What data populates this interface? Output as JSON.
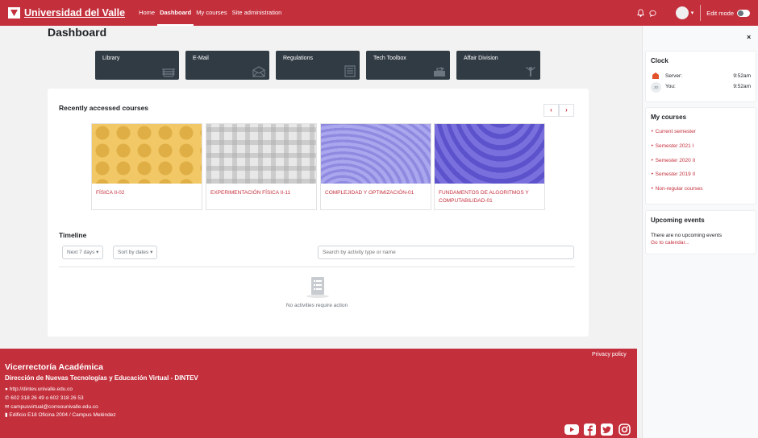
{
  "brand": {
    "name": "Universidad del Valle"
  },
  "nav": {
    "links": [
      "Home",
      "Dashboard",
      "My courses",
      "Site administration"
    ],
    "edit_mode_label": "Edit mode"
  },
  "page": {
    "title": "Dashboard"
  },
  "tiles": [
    {
      "label": "Library",
      "icon": "books-icon"
    },
    {
      "label": "E-Mail",
      "icon": "envelope-icon"
    },
    {
      "label": "Regulations",
      "icon": "list-icon"
    },
    {
      "label": "Tech Toolbox",
      "icon": "toolbox-icon"
    },
    {
      "label": "Affair Division",
      "icon": "person-icon"
    }
  ],
  "recent": {
    "title": "Recently accessed courses",
    "prev_glyph": "‹",
    "next_glyph": "›",
    "courses": [
      {
        "name": "FÍSICA II-02",
        "pattern": "yellow-hexagons"
      },
      {
        "name": "EXPERIMENTACIÓN FÍSICA II-11",
        "pattern": "grey-plaid"
      },
      {
        "name": "COMPLEJIDAD Y OPTIMIZACIÓN-01",
        "pattern": "lavender-waves"
      },
      {
        "name": "FUNDAMENTOS DE ALGORITMOS Y COMPUTABILIDAD-01",
        "pattern": "purple-waves"
      }
    ]
  },
  "timeline": {
    "title": "Timeline",
    "range_filter": "Next 7 days",
    "sort_filter": "Sort by dates",
    "search_placeholder": "Search by activity type or name",
    "empty_text": "No activities require action"
  },
  "drawer": {
    "close_glyph": "×",
    "clock": {
      "title": "Clock",
      "server_label": "Server:",
      "server_time": "9:52am",
      "you_label": "You:",
      "you_time": "9:52am",
      "you_initials": "JO"
    },
    "my_courses": {
      "title": "My courses",
      "items": [
        "Current semester",
        "Semester 2021 I",
        "Semester 2020 II",
        "Semester 2019 II",
        "Non-regular courses"
      ]
    },
    "upcoming": {
      "title": "Upcoming events",
      "empty_text": "There are no upcoming events",
      "calendar_link": "Go to calendar..."
    }
  },
  "footer": {
    "privacy_link": "Privacy policy",
    "org_title": "Vicerrectoría Académica",
    "org_subtitle": "Dirección de Nuevas Tecnologías y Educación Virtual - DINTEV",
    "website": "http://dintev.univalle.edu.co",
    "phones": "602 318 26 49 o 602 318 26 53",
    "email": "campusvirtual@correounivalle.edu.co",
    "address": "Edificio E18 Oficina 2004 / Campus Meléndez",
    "social": [
      "youtube-icon",
      "facebook-icon",
      "twitter-icon",
      "instagram-icon"
    ]
  },
  "colors": {
    "brand_red": "#c42f3c",
    "tile_bg": "#313b44",
    "page_bg": "#f2f2f2"
  }
}
